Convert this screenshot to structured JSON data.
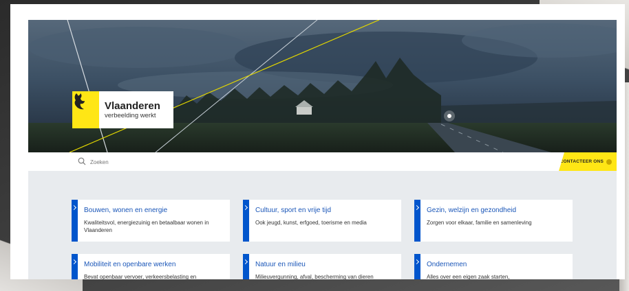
{
  "brand": {
    "name": "Vlaanderen",
    "tagline": "verbeelding werkt"
  },
  "search": {
    "placeholder": "Zoeken"
  },
  "header": {
    "contact_label": "CONTACTEER ONS"
  },
  "tiles": [
    {
      "title": "Bouwen, wonen en energie",
      "description": "Kwaliteitsvol, energiezuinig en betaalbaar wonen in Vlaanderen"
    },
    {
      "title": "Cultuur, sport en vrije tijd",
      "description": "Ook jeugd, kunst, erfgoed, toerisme en media"
    },
    {
      "title": "Gezin, welzijn en gezondheid",
      "description": "Zorgen voor elkaar, familie en samenleving"
    },
    {
      "title": "Mobiliteit en openbare werken",
      "description": "Bevat openbaar vervoer, verkeersbelasting en"
    },
    {
      "title": "Natuur en milieu",
      "description": "Milieuvergunning, afval, bescherming van dieren"
    },
    {
      "title": "Ondernemen",
      "description": "Alles over een eigen zaak starten,"
    }
  ],
  "colors": {
    "brand_yellow": "#ffe615",
    "link_blue": "#1a56b8",
    "marker_blue": "#0055cc",
    "content_bg": "#e8ebee"
  },
  "icons": {
    "search": "search-icon",
    "tile_arrow": "chevron-right-icon",
    "logo": "lion-icon"
  }
}
